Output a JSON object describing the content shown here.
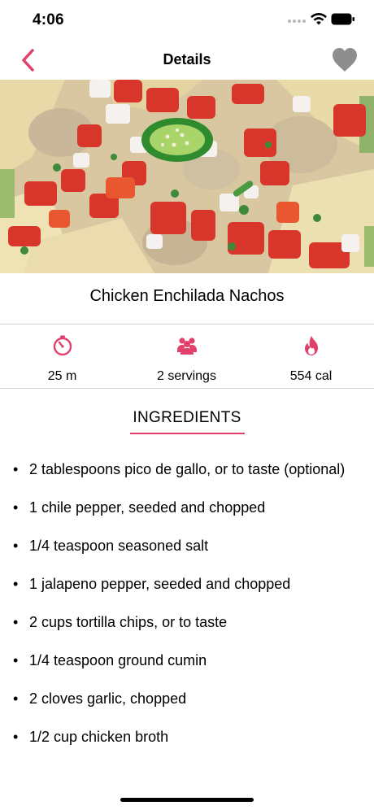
{
  "status_bar": {
    "time": "4:06"
  },
  "nav": {
    "title": "Details",
    "back_icon": "chevron-left-icon",
    "favorite_icon": "heart-icon"
  },
  "recipe": {
    "title": "Chicken Enchilada Nachos",
    "image_icon": "recipe-photo"
  },
  "stats": [
    {
      "icon": "timer-icon",
      "label": "25 m"
    },
    {
      "icon": "users-icon",
      "label": "2 servings"
    },
    {
      "icon": "flame-icon",
      "label": "554 cal"
    }
  ],
  "ingredients": {
    "heading": "INGREDIENTS",
    "bullet": "•",
    "items": [
      "2 tablespoons pico de gallo, or to taste (optional)",
      "1 chile pepper, seeded and chopped",
      "1/4 teaspoon seasoned salt",
      "1 jalapeno pepper, seeded and chopped",
      "2 cups tortilla chips, or to taste",
      "1/4 teaspoon ground cumin",
      "2 cloves garlic, chopped",
      "1/2 cup chicken broth"
    ]
  },
  "colors": {
    "accent": "#e0406a",
    "favorite_inactive": "#8e8e8e",
    "divider": "#cfcfcf"
  }
}
